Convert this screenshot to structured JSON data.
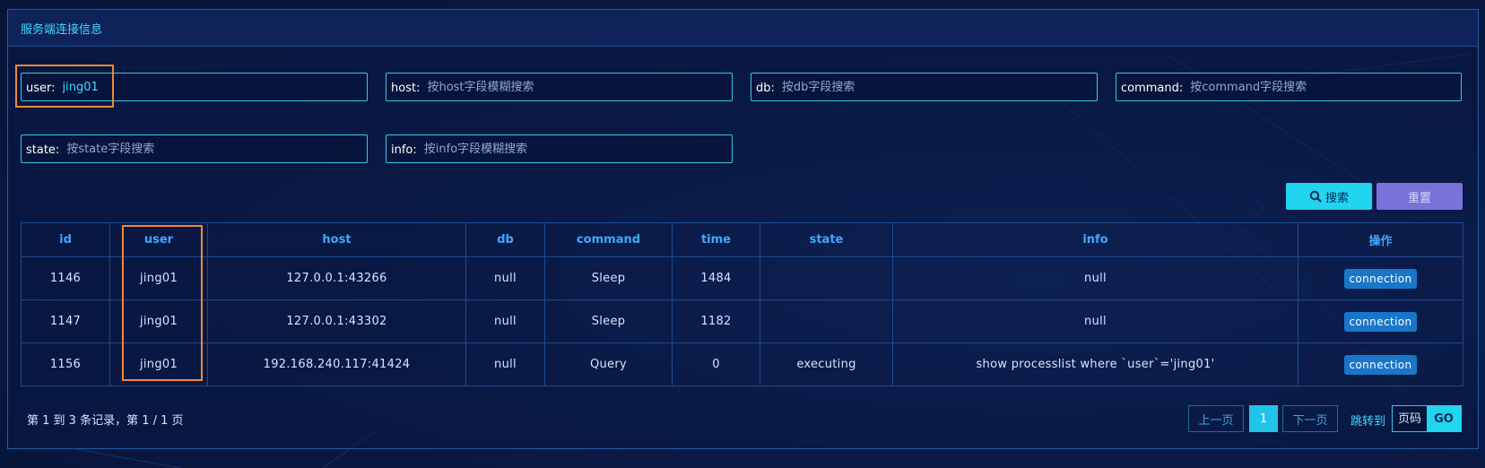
{
  "panel": {
    "title": "服务端连接信息"
  },
  "filters": {
    "user": {
      "label": "user:",
      "value": "jing01",
      "placeholder": ""
    },
    "host": {
      "label": "host:",
      "value": "",
      "placeholder": "按host字段模糊搜索"
    },
    "db": {
      "label": "db:",
      "value": "",
      "placeholder": "按db字段搜索"
    },
    "command": {
      "label": "command:",
      "value": "",
      "placeholder": "按command字段搜索"
    },
    "state": {
      "label": "state:",
      "value": "",
      "placeholder": "按state字段搜索"
    },
    "info": {
      "label": "info:",
      "value": "",
      "placeholder": "按info字段模糊搜索"
    }
  },
  "actions": {
    "search_label": "搜索",
    "reset_label": "重置",
    "search_icon": "search-icon"
  },
  "table": {
    "headers": [
      "id",
      "user",
      "host",
      "db",
      "command",
      "time",
      "state",
      "info",
      "操作"
    ],
    "rows": [
      {
        "id": "1146",
        "user": "jing01",
        "host": "127.0.0.1:43266",
        "db": "null",
        "command": "Sleep",
        "time": "1484",
        "state": "",
        "info": "null",
        "action": "connection"
      },
      {
        "id": "1147",
        "user": "jing01",
        "host": "127.0.0.1:43302",
        "db": "null",
        "command": "Sleep",
        "time": "1182",
        "state": "",
        "info": "null",
        "action": "connection"
      },
      {
        "id": "1156",
        "user": "jing01",
        "host": "192.168.240.117:41424",
        "db": "null",
        "command": "Query",
        "time": "0",
        "state": "executing",
        "info": "show processlist where `user`='jing01'",
        "action": "connection"
      }
    ]
  },
  "pagination": {
    "summary": "第 1 到 3 条记录，第 1 / 1 页",
    "prev_label": "上一页",
    "current_page": "1",
    "next_label": "下一页",
    "jump_label": "跳转到",
    "page_input_placeholder": "页码",
    "go_label": "GO"
  },
  "colors": {
    "accent": "#21d4ef",
    "header_text": "#3fa8ff",
    "highlight": "#f0883a",
    "reset": "#7a72db",
    "action_button": "#1976c9"
  }
}
